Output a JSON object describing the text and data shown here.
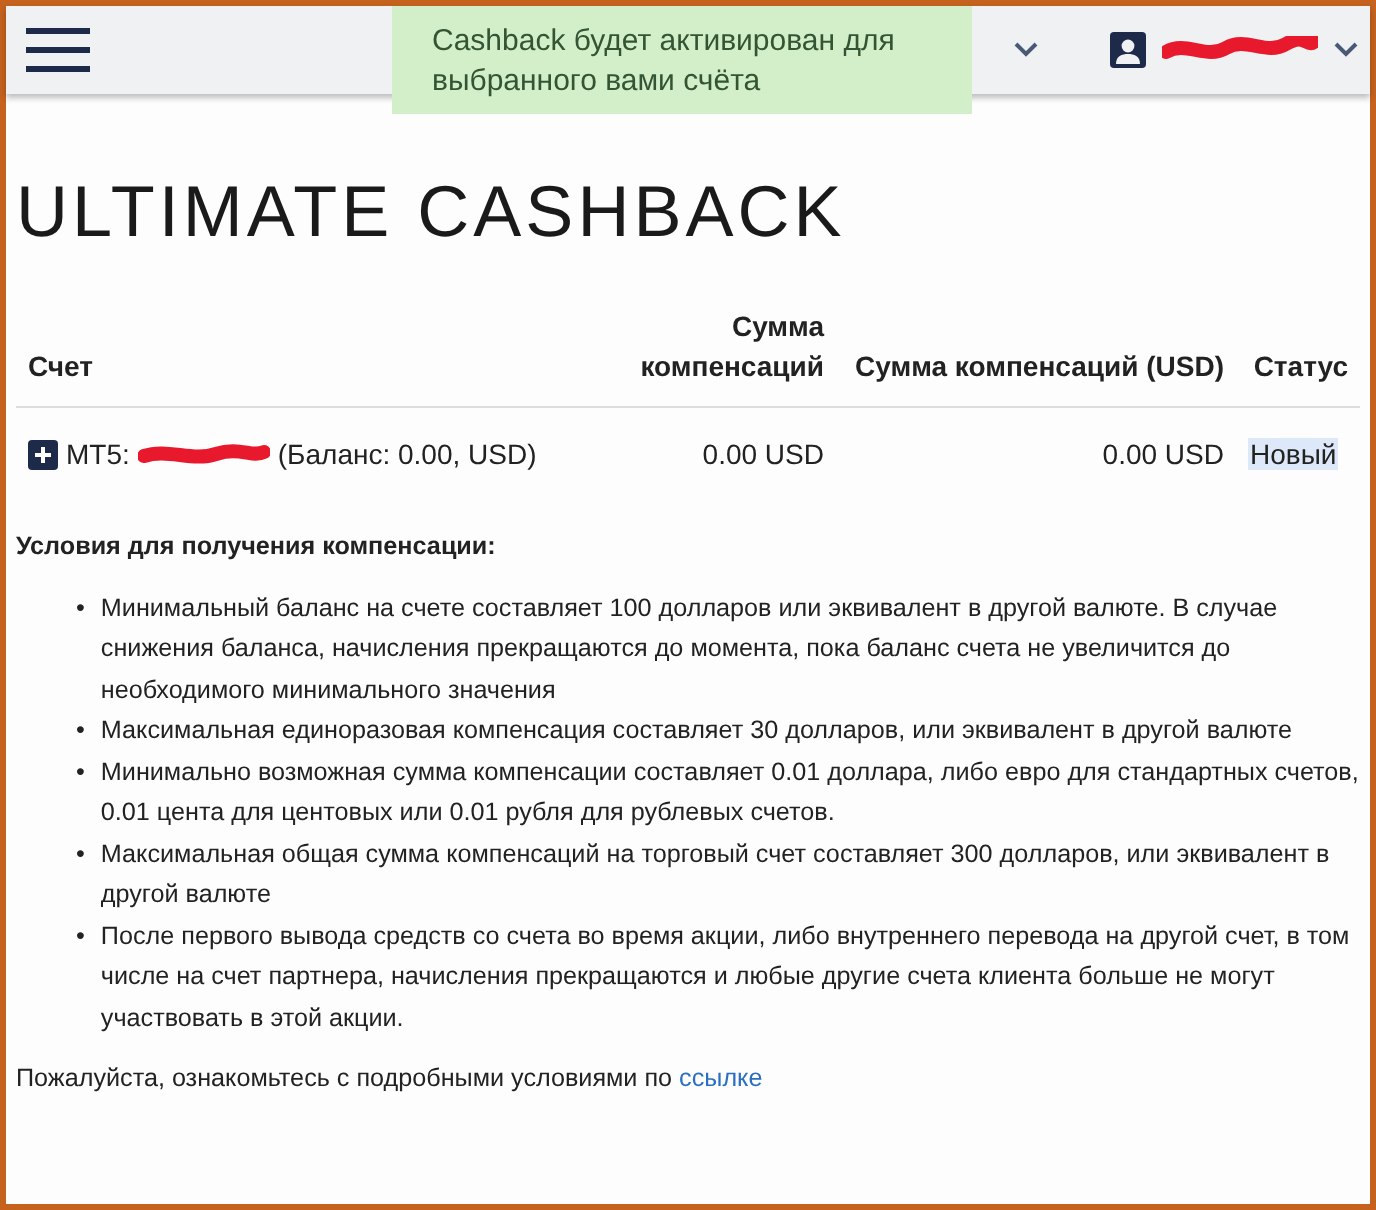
{
  "header": {
    "toast": "Cashback будет активирован для выбранного вами счёта"
  },
  "title": "ULTIMATE CASHBACK",
  "table": {
    "columns": [
      "Счет",
      "Сумма компенсаций",
      "Сумма компенсаций (USD)",
      "Статус"
    ],
    "rows": [
      {
        "account_prefix": "MT5:",
        "account_suffix": "(Баланс: 0.00, USD)",
        "amount": "0.00 USD",
        "amount_usd": "0.00 USD",
        "status": "Новый"
      }
    ]
  },
  "conditions": {
    "heading": "Условия для получения компенсации:",
    "items": [
      {
        "bullet": "•",
        "text": "Минимальный баланс на счете составляет 100 долларов или эквивалент в другой валюте. В случае снижения баланса, начисления прекращаются до момента, пока баланс счета не увеличится до необходимого минимального значения"
      },
      {
        "bullet": "•",
        "text": "Максимальная единоразовая компенсация составляет 30 долларов, или эквивалент в другой валюте"
      },
      {
        "bullet": "•",
        "text": "Минимально возможная сумма компенсации составляет 0.01 доллара, либо евро для стандартных счетов, 0.01 цента для центовых или 0.01 рубля для рублевых счетов."
      },
      {
        "bullet": "•",
        "text": "Максимальная общая сумма компенсаций на торговый счет составляет 300 долларов, или эквивалент в другой валюте"
      },
      {
        "bullet": "•",
        "text": "После первого вывода средств со счета во время акции, либо внутреннего перевода на другой счет, в том числе на счет партнера, начисления прекращаются и любые другие счета клиента больше не могут участвовать в этой акции."
      }
    ]
  },
  "note": {
    "text": "Пожалуйста, ознакомьтесь с подробными условиями по ",
    "link": "ссылке"
  }
}
